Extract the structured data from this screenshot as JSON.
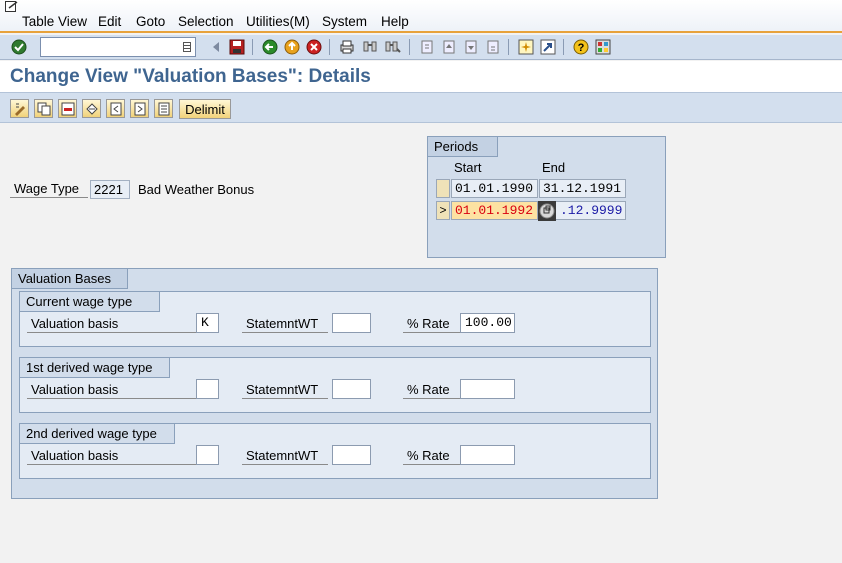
{
  "menu": {
    "items": [
      "Table View",
      "Edit",
      "Goto",
      "Selection",
      "Utilities(M)",
      "System",
      "Help"
    ]
  },
  "toolbar": {
    "command_value": "",
    "icons": [
      "enter-icon",
      "back-icon",
      "save-icon",
      "back-nav-icon",
      "exit-icon",
      "cancel-icon",
      "print-icon",
      "find-icon",
      "find-next-icon",
      "first-page-icon",
      "prev-page-icon",
      "next-page-icon",
      "last-page-icon",
      "new-session-icon",
      "shortcut-icon",
      "help-icon",
      "layout-icon"
    ]
  },
  "page": {
    "title": "Change View \"Valuation Bases\": Details"
  },
  "app_toolbar": {
    "delimit_label": "Delimit"
  },
  "wage_type": {
    "label": "Wage Type",
    "code": "2221",
    "description": "Bad Weather Bonus"
  },
  "periods": {
    "title": "Periods",
    "start_header": "Start",
    "end_header": "End",
    "rows": [
      {
        "selector": "",
        "start": "01.01.1990",
        "end": "31.12.1991"
      },
      {
        "selector": ">",
        "start": "01.01.1992",
        "end": ".12.9999"
      }
    ]
  },
  "valuation_bases": {
    "title": "Valuation Bases",
    "groups": [
      {
        "title": "Current wage type",
        "valuation_label": "Valuation basis",
        "valuation_value": "K",
        "statement_label": "StatemntWT",
        "statement_value": "",
        "rate_label": "% Rate",
        "rate_value": "100.00"
      },
      {
        "title": "1st derived wage type",
        "valuation_label": "Valuation basis",
        "valuation_value": "",
        "statement_label": "StatemntWT",
        "statement_value": "",
        "rate_label": "% Rate",
        "rate_value": ""
      },
      {
        "title": "2nd derived wage type",
        "valuation_label": "Valuation basis",
        "valuation_value": "",
        "statement_label": "StatemntWT",
        "statement_value": "",
        "rate_label": "% Rate",
        "rate_value": ""
      }
    ]
  },
  "colors": {
    "title": "#3f6590",
    "toolbar": "#d3dfee",
    "accent_line": "#e7a23b",
    "highlight_date": "#d9000f",
    "end_date_blue": "#1a1aa6"
  }
}
